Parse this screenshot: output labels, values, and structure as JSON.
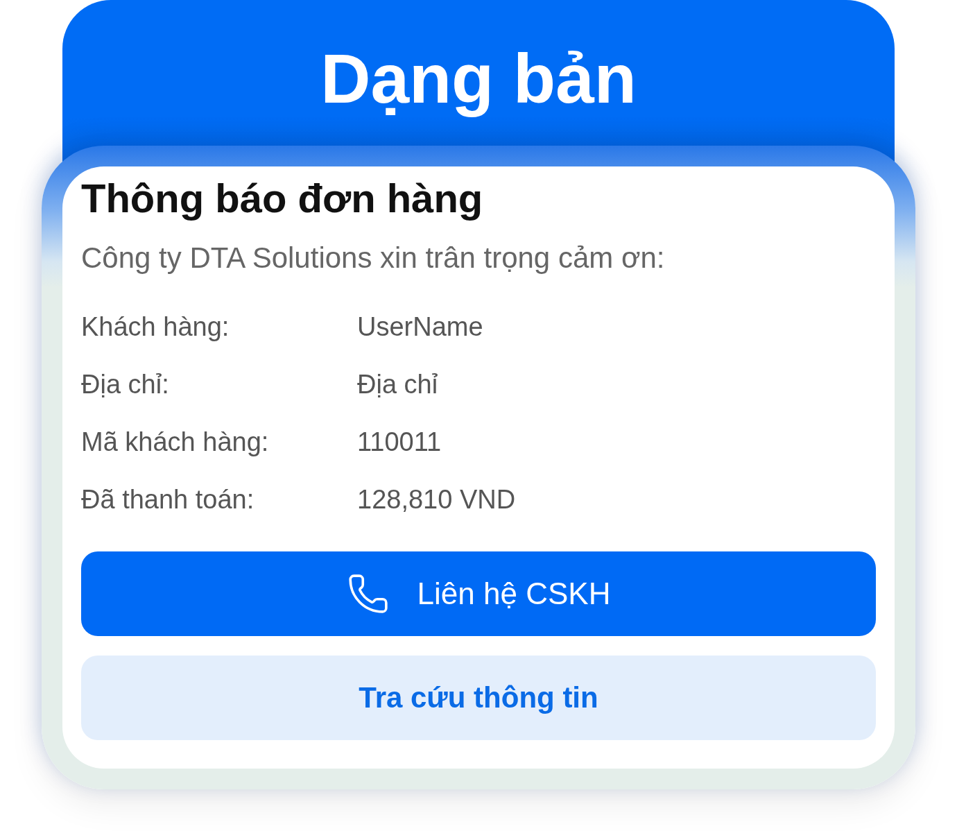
{
  "banner": {
    "title": "Dạng bản"
  },
  "card": {
    "title": "Thông báo đơn hàng",
    "subtitle": "Công ty DTA Solutions xin trân trọng cảm ơn:",
    "fields": [
      {
        "label": "Khách hàng:",
        "value": "UserName"
      },
      {
        "label": "Địa chỉ:",
        "value": "Địa chỉ"
      },
      {
        "label": "Mã khách hàng:",
        "value": "110011"
      },
      {
        "label": "Đã thanh toán:",
        "value": "128,810 VND"
      }
    ],
    "buttons": [
      {
        "kind": "primary",
        "label": "Liên hệ CSKH"
      },
      {
        "kind": "secondary",
        "label": "Tra cứu thông tin"
      }
    ]
  }
}
